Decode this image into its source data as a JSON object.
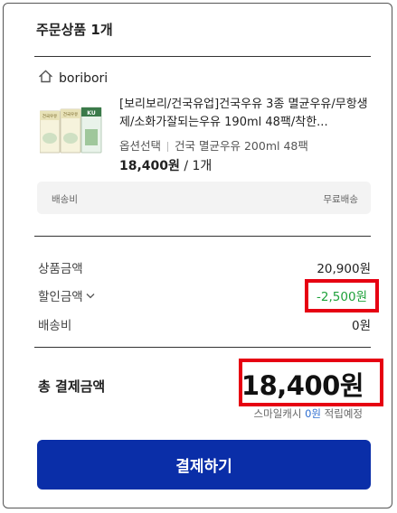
{
  "order": {
    "title": "주문상품 1개",
    "shop_name": "boribori",
    "product": {
      "name": "[보리보리/건국유업]건국우유 3종 멸균우유/무항생제/소화가잘되는우유 190ml 48팩/착한...",
      "option_label": "옵션선택",
      "option_value": "건국 멸균우유 200ml 48팩",
      "price": "18,400원",
      "quantity": " / 1개",
      "thumb_text": [
        "건국우유",
        "건국우유",
        "KU"
      ]
    },
    "shipping": {
      "label": "배송비",
      "value": "무료배송"
    }
  },
  "summary": {
    "items": [
      {
        "label": "상품금액",
        "value": "20,900원"
      },
      {
        "label": "할인금액",
        "value": "-2,500원"
      },
      {
        "label": "배송비",
        "value": "0원"
      }
    ],
    "total_label": "총 결제금액",
    "total_value": "18,400원",
    "points_prefix": "스마일캐시 ",
    "points_value": "0원",
    "points_suffix": " 적립예정"
  },
  "pay_button": "결제하기",
  "colors": {
    "primary": "#0a2ea8",
    "discount": "#1ea13a",
    "highlight": "#e60012"
  }
}
